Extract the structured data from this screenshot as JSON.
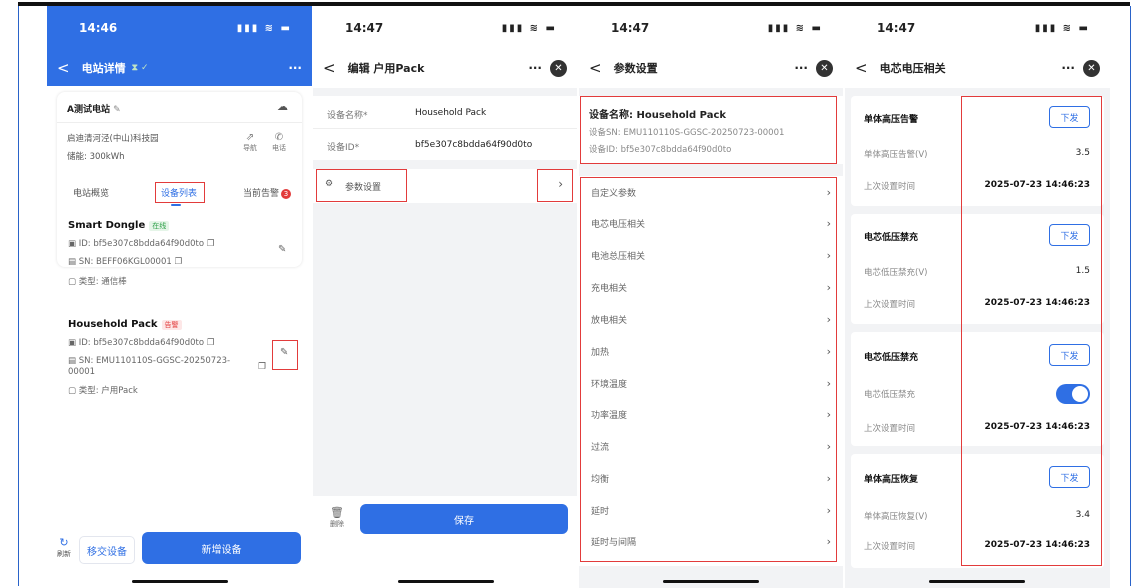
{
  "panel1": {
    "time": "14:46",
    "status_icons": "▮▮▮ ≋ ▬",
    "title": "电站详情",
    "title_suffix": "⧗ ✓",
    "more": "···",
    "station_name": "A测试电站",
    "address": "启迪清河泾(中山)科技园",
    "capacity": "储能: 300kWh",
    "nav_label": "导航",
    "call_label": "电话",
    "tabs": [
      "电站概览",
      "设备列表",
      "当前告警"
    ],
    "alarm_count": "3",
    "devices": [
      {
        "name": "Smart Dongle",
        "tag": "在线",
        "id": "ID: bf5e307c8bdda64f90d0to",
        "sn": "SN: BEFF06KGL00001",
        "type": "类型: 通信棒"
      },
      {
        "name": "Household Pack",
        "tag": "告警",
        "id": "ID: bf5e307c8bdda64f90d0to",
        "sn": "SN: EMU110110S-GGSC-20250723-00001",
        "type": "类型: 户用Pack"
      }
    ],
    "refresh_label": "刷新",
    "move_button": "移交设备",
    "add_button": "新增设备"
  },
  "panel2": {
    "time": "14:47",
    "status_icons": "▮▮▮ ≋ ▬",
    "title": "编辑 户用Pack",
    "more": "···",
    "fields": [
      {
        "label": "设备名称*",
        "value": "Household Pack"
      },
      {
        "label": "设备ID*",
        "value": "bf5e307c8bdda64f90d0to"
      }
    ],
    "param_label": "参数设置",
    "delete_label": "删除",
    "save_button": "保存"
  },
  "panel3": {
    "time": "14:47",
    "status_icons": "▮▮▮ ≋ ▬",
    "title": "参数设置",
    "more": "···",
    "device_name": "设备名称: Household Pack",
    "device_sn": "设备SN: EMU110110S-GGSC-20250723-00001",
    "device_id": "设备ID: bf5e307c8bdda64f90d0to",
    "items": [
      "自定义参数",
      "电芯电压相关",
      "电池总压相关",
      "充电相关",
      "放电相关",
      "加热",
      "环境温度",
      "功率温度",
      "过流",
      "均衡",
      "延时",
      "延时与间隔"
    ]
  },
  "panel4": {
    "time": "14:47",
    "status_icons": "▮▮▮ ≋ ▬",
    "title": "电芯电压相关",
    "more": "···",
    "send_label": "下发",
    "last_set_label": "上次设置时间",
    "cards": [
      {
        "title": "单体高压告警",
        "param_label": "单体高压告警(V)",
        "value": "3.5",
        "time": "2025-07-23 14:46:23"
      },
      {
        "title": "电芯低压禁充",
        "param_label": "电芯低压禁充(V)",
        "value": "1.5",
        "time": "2025-07-23 14:46:23"
      },
      {
        "title": "电芯低压禁充",
        "param_label": "电芯低压禁充",
        "toggle_on": true,
        "time": "2025-07-23 14:46:23"
      },
      {
        "title": "单体高压恢复",
        "param_label": "单体高压恢复(V)",
        "value": "3.4",
        "time": "2025-07-23 14:46:23"
      }
    ]
  }
}
